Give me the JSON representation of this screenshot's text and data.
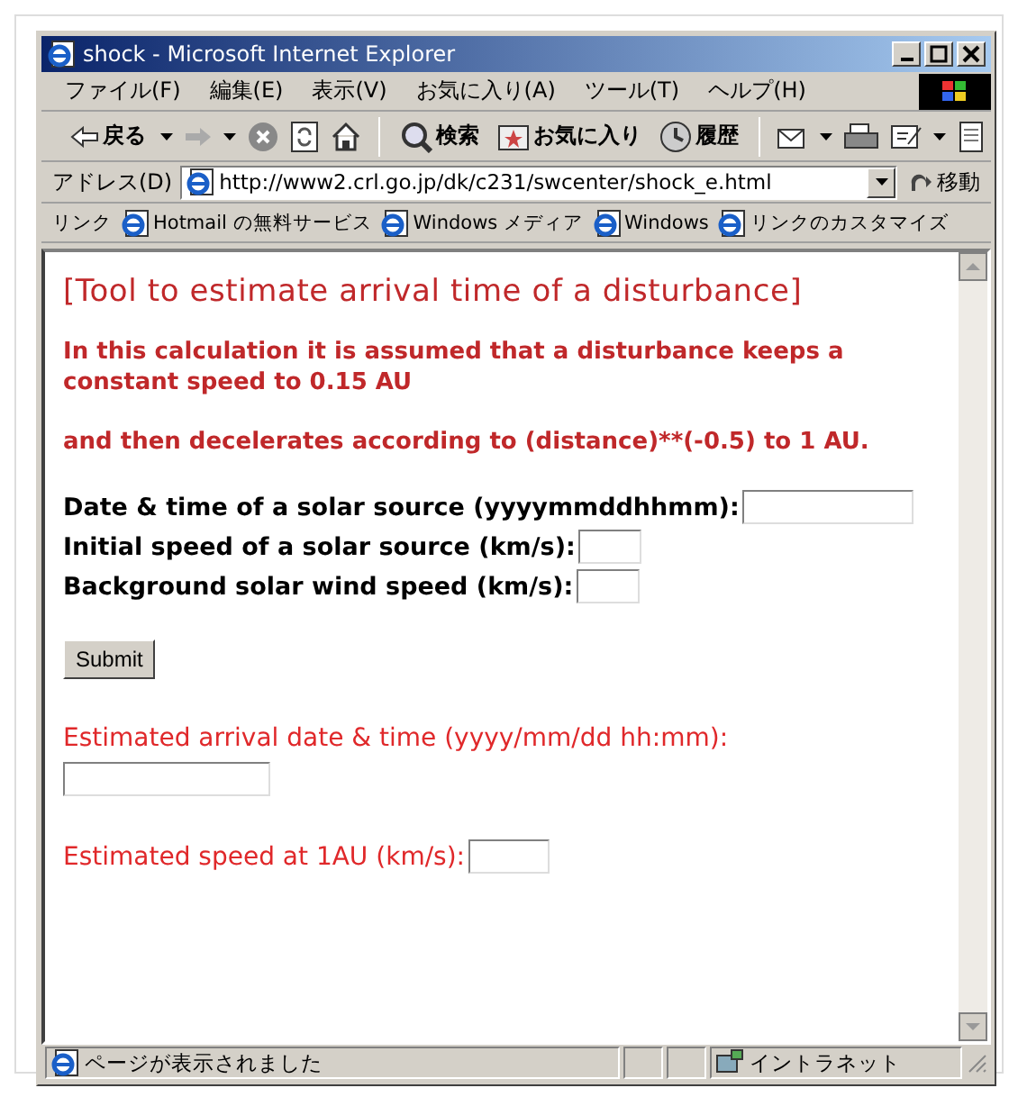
{
  "window": {
    "title": "shock - Microsoft Internet Explorer"
  },
  "menu": [
    "ファイル(F)",
    "編集(E)",
    "表示(V)",
    "お気に入り(A)",
    "ツール(T)",
    "ヘルプ(H)"
  ],
  "toolbar": [
    {
      "kind": "back",
      "label": "戻る"
    },
    {
      "kind": "forward"
    },
    {
      "kind": "stop"
    },
    {
      "kind": "refresh"
    },
    {
      "kind": "home"
    },
    {
      "kind": "search",
      "label": "検索"
    },
    {
      "kind": "favorites",
      "label": "お気に入り"
    },
    {
      "kind": "history",
      "label": "履歴"
    },
    {
      "kind": "mail"
    },
    {
      "kind": "print"
    },
    {
      "kind": "edit"
    },
    {
      "kind": "discuss"
    }
  ],
  "address": {
    "label": "アドレス(D)",
    "value": "http://www2.crl.go.jp/dk/c231/swcenter/shock_e.html",
    "go": "移動"
  },
  "links": {
    "label": "リンク",
    "items": [
      "Hotmail の無料サービス",
      "Windows メディア",
      "Windows",
      "リンクのカスタマイズ"
    ]
  },
  "page": {
    "heading": "[Tool to estimate arrival time of a disturbance]",
    "paragraphs": [
      "In this calculation it is assumed that a disturbance keeps a constant speed to 0.15 AU",
      "and then decelerates according to (distance)**(-0.5) to 1 AU."
    ],
    "inputs": [
      {
        "label": "Date & time of a solar source (yyyymmddhhmm):"
      },
      {
        "label": "Initial speed of a solar source (km/s):"
      },
      {
        "label": "Background solar wind speed (km/s):"
      }
    ],
    "submit": "Submit",
    "outputs": [
      {
        "label": "Estimated arrival date & time (yyyy/mm/dd hh:mm):"
      },
      {
        "label": "Estimated speed at 1AU (km/s):"
      }
    ]
  },
  "status": {
    "text": "ページが表示されました",
    "zone": "イントラネット"
  }
}
